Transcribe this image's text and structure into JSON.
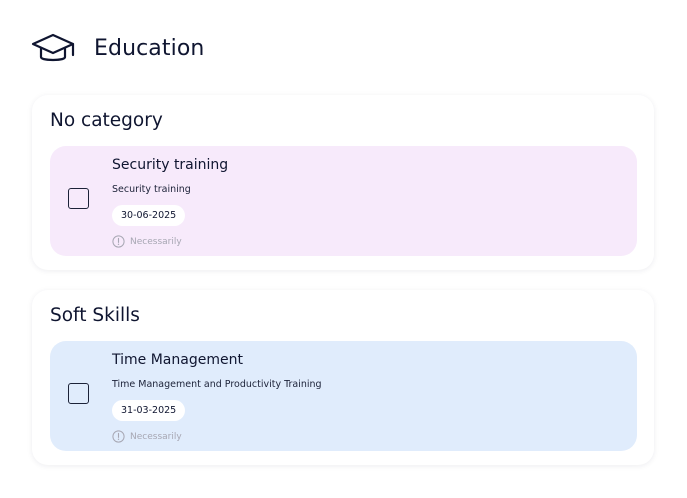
{
  "header": {
    "title": "Education",
    "icon": "graduation-cap-icon"
  },
  "categories": [
    {
      "title": "No category",
      "items": [
        {
          "title": "Security training",
          "description": "Security training",
          "date": "30-06-2025",
          "status": "Necessarily",
          "checked": false,
          "color": "#f7eafb"
        }
      ]
    },
    {
      "title": "Soft Skills",
      "items": [
        {
          "title": "Time Management",
          "description": "Time Management and Productivity Training",
          "date": "31-03-2025",
          "status": "Necessarily",
          "checked": false,
          "color": "#e0ecfc"
        }
      ]
    }
  ],
  "colors": {
    "text_primary": "#0f1530",
    "text_muted": "#a7a7b3",
    "card_pink": "#f7eafb",
    "card_blue": "#e0ecfc"
  }
}
